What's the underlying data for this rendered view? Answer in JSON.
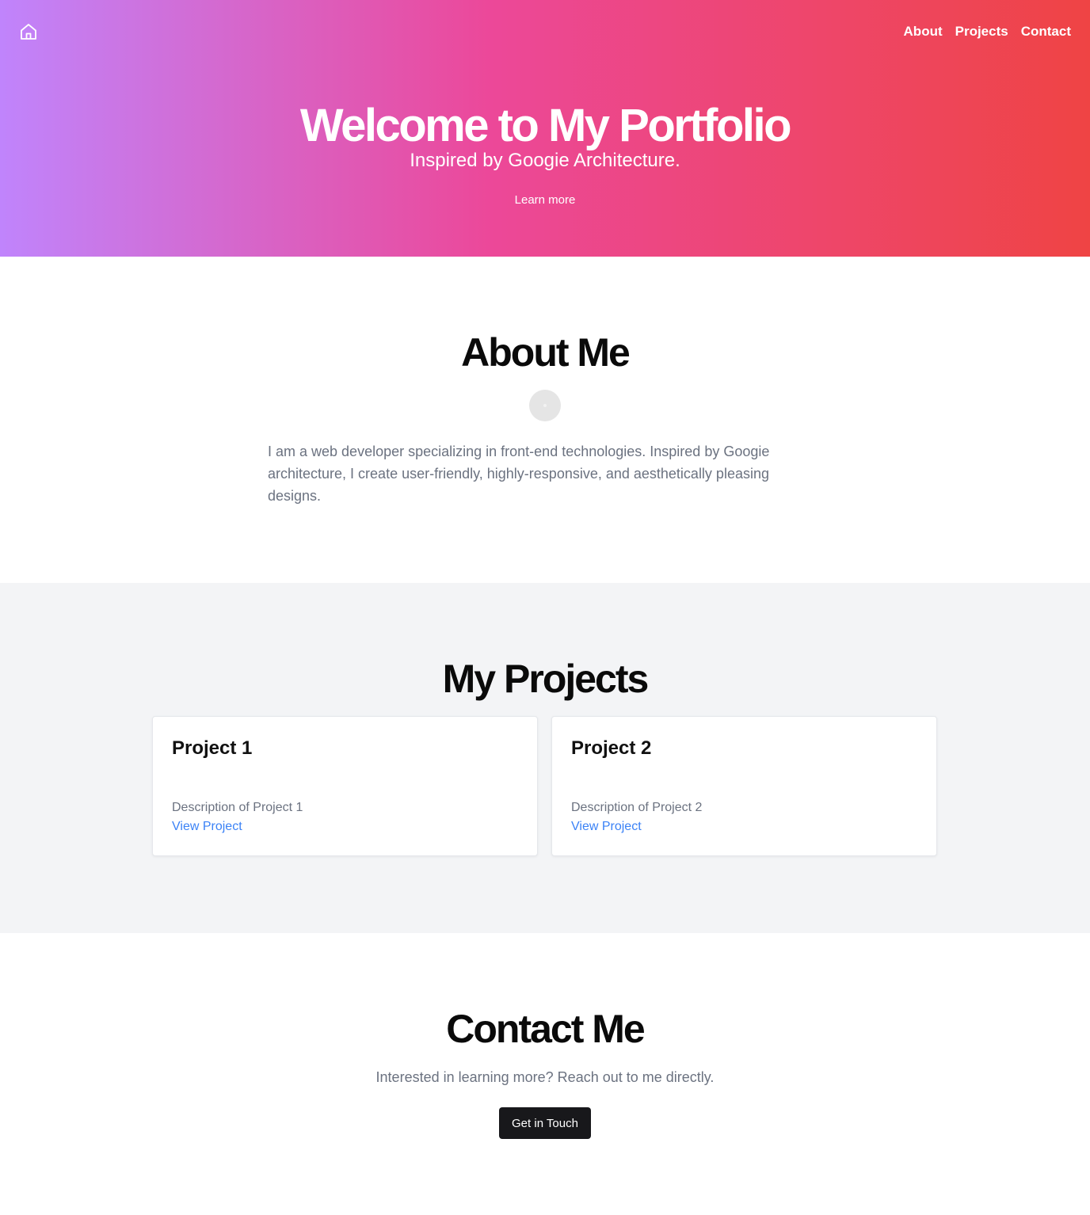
{
  "header": {
    "home_icon": "home-icon",
    "nav": [
      "About",
      "Projects",
      "Contact"
    ]
  },
  "hero": {
    "title": "Welcome to My Portfolio",
    "subtitle": "Inspired by Googie Architecture.",
    "button": "Learn more"
  },
  "about": {
    "title": "About Me",
    "text": "I am a web developer specializing in front-end technologies. Inspired by Googie architecture, I create user-friendly, highly-responsive, and aesthetically pleasing designs."
  },
  "projects": {
    "title": "My Projects",
    "items": [
      {
        "title": "Project 1",
        "description": "Description of Project 1",
        "link": "View Project"
      },
      {
        "title": "Project 2",
        "description": "Description of Project 2",
        "link": "View Project"
      }
    ]
  },
  "contact": {
    "title": "Contact Me",
    "text": "Interested in learning more? Reach out to me directly.",
    "button": "Get in Touch"
  },
  "colors": {
    "gradient_start": "#c084fc",
    "gradient_mid": "#ec4899",
    "gradient_end": "#ef4444",
    "link": "#3b82f6",
    "button": "#18181b"
  }
}
